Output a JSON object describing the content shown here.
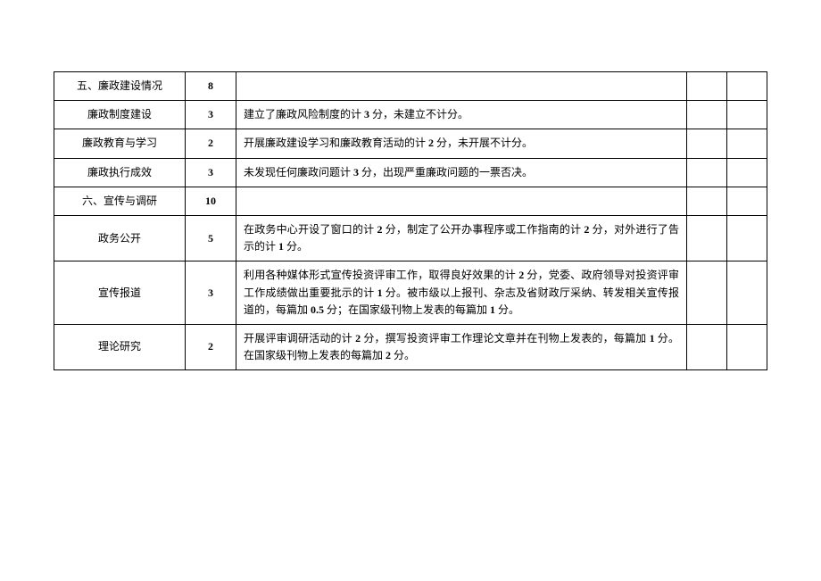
{
  "rows": [
    {
      "label": "五、廉政建设情况",
      "score": "8",
      "desc": ""
    },
    {
      "label": "廉政制度建设",
      "score": "3",
      "desc": "建立了廉政风险制度的计 3 分，未建立不计分。"
    },
    {
      "label": "廉政教育与学习",
      "score": "2",
      "desc": "开展廉政建设学习和廉政教育活动的计 2 分，未开展不计分。"
    },
    {
      "label": "廉政执行成效",
      "score": "3",
      "desc": "未发现任何廉政问题计 3 分，出现严重廉政问题的一票否决。"
    },
    {
      "label": "六、宣传与调研",
      "score": "10",
      "desc": ""
    },
    {
      "label": "政务公开",
      "score": "5",
      "desc": "在政务中心开设了窗口的计 2 分，制定了公开办事程序或工作指南的计 2 分，对外进行了告示的计 1 分。"
    },
    {
      "label": "宣传报道",
      "score": "3",
      "desc": "利用各种媒体形式宣传投资评审工作，取得良好效果的计 2 分，党委、政府领导对投资评审工作成绩做出重要批示的计 1 分。被市级以上报刊、杂志及省财政厅采纳、转发相关宣传报道的，每篇加 0.5 分；在国家级刊物上发表的每篇加 1 分。"
    },
    {
      "label": "理论研究",
      "score": "2",
      "desc": "开展评审调研活动的计 2 分，撰写投资评审工作理论文章并在刊物上发表的，每篇加 1 分。在国家级刊物上发表的每篇加 2 分。"
    }
  ]
}
